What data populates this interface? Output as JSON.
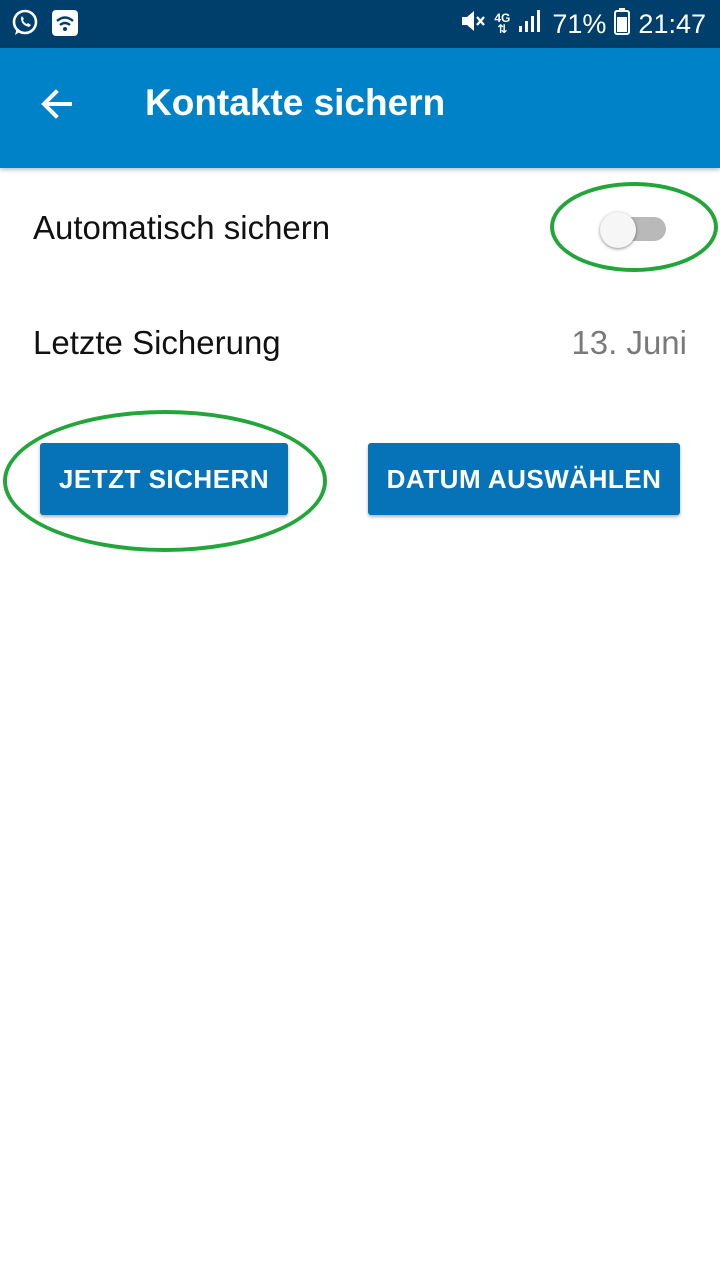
{
  "status_bar": {
    "battery_percent": "71%",
    "time": "21:47",
    "network": "4G",
    "icons": [
      "whatsapp-icon",
      "wifi-notification-icon",
      "mute-icon",
      "data-arrows-icon",
      "signal-icon",
      "battery-icon"
    ]
  },
  "app_bar": {
    "title": "Kontakte sichern",
    "back_icon": "arrow-back-icon",
    "color": "#0082c8"
  },
  "settings": {
    "auto_backup": {
      "label": "Automatisch sichern",
      "enabled": false
    },
    "last_backup": {
      "label": "Letzte Sicherung",
      "value": "13. Juni"
    }
  },
  "actions": {
    "backup_now_label": "JETZT SICHERN",
    "select_date_label": "DATUM AUSWÄHLEN",
    "button_color": "#0673b8"
  },
  "annotations": {
    "color": "#22a63a"
  }
}
